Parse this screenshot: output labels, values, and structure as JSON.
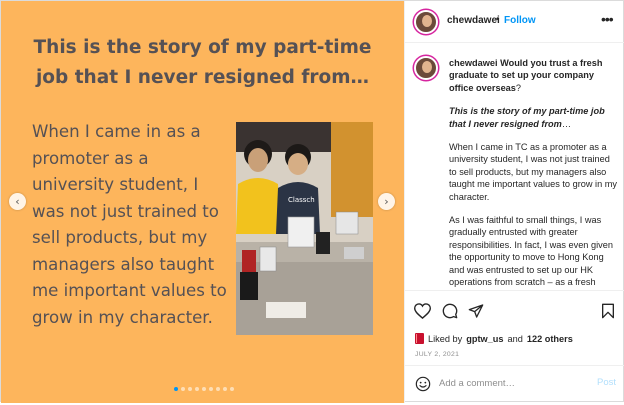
{
  "media": {
    "title": "This is the story of my part-time job that I never resigned from…",
    "body": "When I came in as a promoter as a university student, I was not just trained to sell products, but my managers also taught me important values to grow in my character.",
    "background_color": "#fdb55c",
    "text_color": "#555155",
    "carousel": {
      "count": 9,
      "active_index": 0
    },
    "photo_sign": "Classch"
  },
  "header": {
    "username": "chewdawei",
    "separator": "•",
    "follow_label": "Follow",
    "more_glyph": "•••"
  },
  "caption": {
    "username": "chewdawei",
    "question": "Would you trust a fresh graduate to set up your company office overseas",
    "question_mark": "?",
    "title": "This is the story of my part-time job that I never resigned from",
    "title_ellipsis": "…",
    "para1": "When I came in TC as a promoter as a university student, I was not just trained to sell products, but my managers also taught me important values to grow in my character.",
    "para2": "As I was faithful to small things, I was gradually entrusted with greater responsibilities. In fact, I was even given the opportunity to move to Hong Kong and was entrusted to set up our HK operations from scratch – as a fresh"
  },
  "actions": {
    "liked_prefix": "Liked by",
    "liked_user": "gptw_us",
    "and": "and",
    "others": "122 others",
    "date": "JULY 2, 2021"
  },
  "comment": {
    "placeholder": "Add a comment…",
    "post_label": "Post"
  },
  "colors": {
    "accent": "#0095f6",
    "muted": "#8e8e8e",
    "border": "#dbdbdb"
  }
}
